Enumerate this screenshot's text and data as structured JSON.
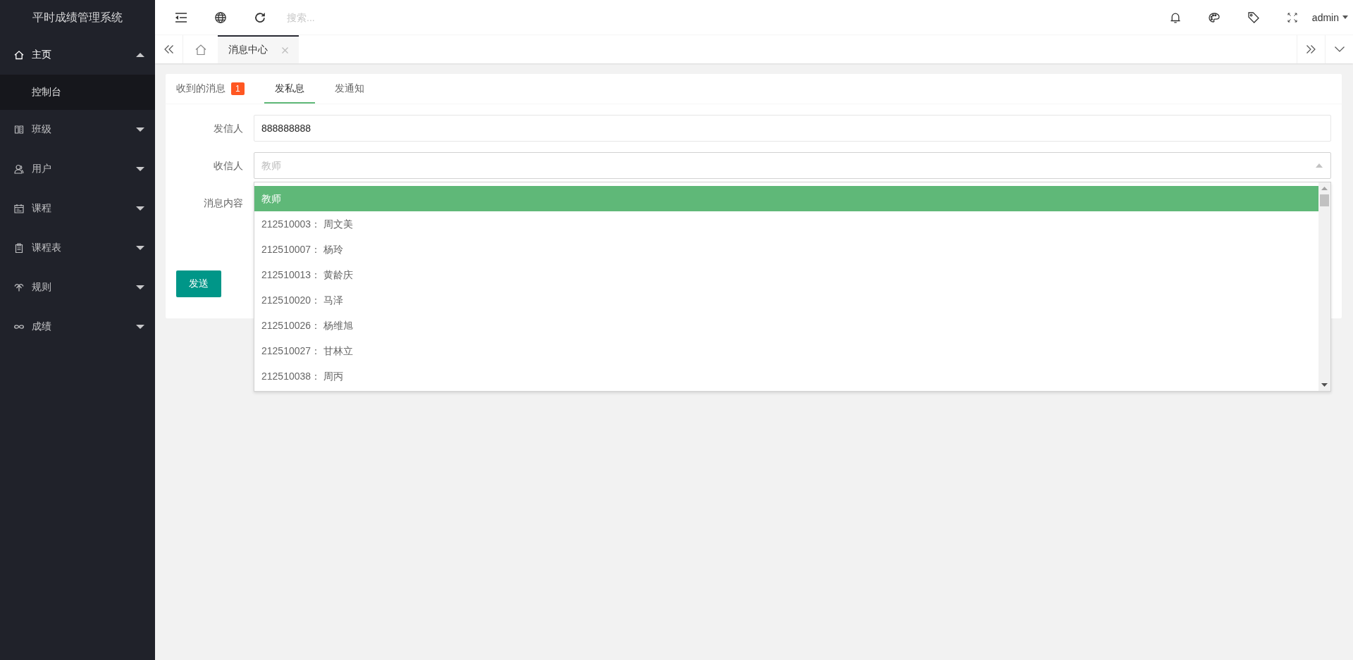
{
  "sidebar": {
    "title": "平时成绩管理系统",
    "items": [
      {
        "label": "主页",
        "expanded": true,
        "children": [
          {
            "label": "控制台"
          }
        ]
      },
      {
        "label": "班级",
        "expanded": false
      },
      {
        "label": "用户",
        "expanded": false
      },
      {
        "label": "课程",
        "expanded": false
      },
      {
        "label": "课程表",
        "expanded": false
      },
      {
        "label": "规则",
        "expanded": false
      },
      {
        "label": "成绩",
        "expanded": false
      }
    ]
  },
  "header": {
    "search": {
      "placeholder": "搜索..."
    },
    "user": "admin"
  },
  "page_tabs": [
    {
      "label": "消息中心",
      "selected": true
    }
  ],
  "card": {
    "tabs": [
      {
        "label": "收到的消息",
        "badge": "1",
        "selected": false
      },
      {
        "label": "发私息",
        "selected": true
      },
      {
        "label": "发通知",
        "selected": false
      }
    ],
    "form": {
      "fields": [
        {
          "kind": "input",
          "label": "发信人",
          "value": "888888888"
        },
        {
          "kind": "select",
          "label": "收信人",
          "placeholder": "教师",
          "open": true,
          "options": [
            {
              "label": "教师",
              "selected": true
            },
            {
              "label": "212510003： 周文美",
              "selected": false
            },
            {
              "label": "212510007： 杨玲",
              "selected": false
            },
            {
              "label": "212510013： 黄龄庆",
              "selected": false
            },
            {
              "label": "212510020： 马泽",
              "selected": false
            },
            {
              "label": "212510026： 杨维旭",
              "selected": false
            },
            {
              "label": "212510027： 甘林立",
              "selected": false
            },
            {
              "label": "212510038： 周丙",
              "selected": false
            }
          ]
        },
        {
          "kind": "textarea",
          "label": "消息内容"
        }
      ],
      "submit": "发送"
    }
  }
}
